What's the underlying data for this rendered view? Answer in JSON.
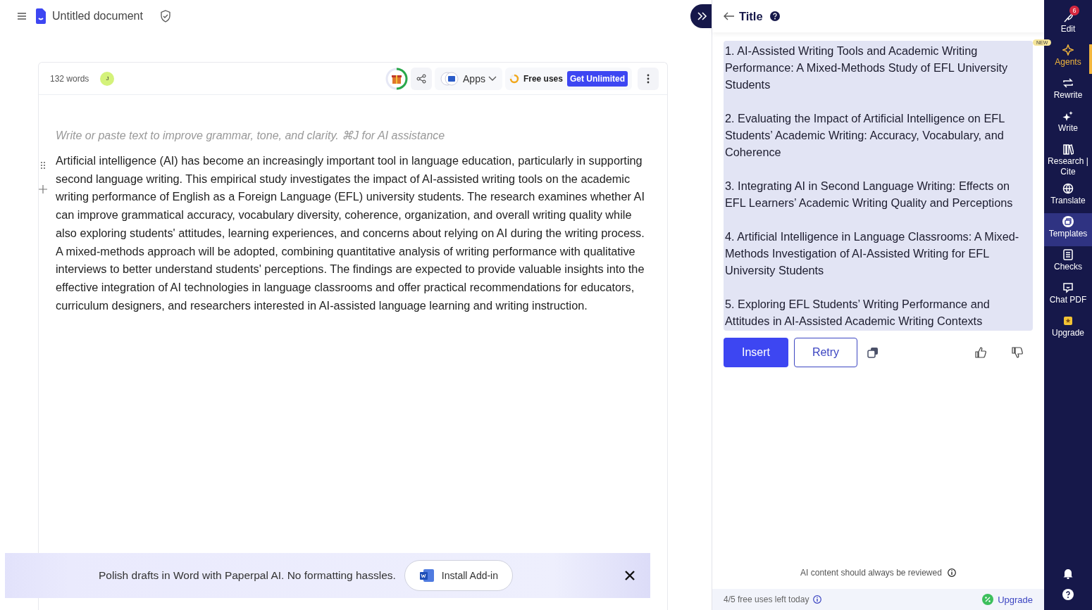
{
  "header": {
    "title": "Untitled document"
  },
  "toolbar": {
    "word_count": "132 words",
    "avatar": "J",
    "apps_label": "Apps",
    "free_uses": "Free uses",
    "get_unlimited": "Get Unlimited"
  },
  "editor": {
    "placeholder": "Write or paste text to improve grammar, tone, and clarity. ⌘J for AI assistance",
    "paragraph": "Artificial intelligence (AI) has become an increasingly important tool in language education, particularly in supporting second language writing. This empirical study investigates the impact of AI-assisted writing tools on the academic writing performance of English as a Foreign Language (EFL) university students. The research examines whether AI can improve grammatical accuracy, vocabulary diversity, coherence, organization, and overall writing quality while also exploring students' attitudes, learning experiences, and concerns about relying on AI during the writing process. A mixed-methods approach will be adopted, combining quantitative analysis of writing performance with qualitative interviews to better understand students' perceptions. The findings are expected to provide valuable insights into the effective integration of AI technologies in language classrooms and offer practical recommendations for educators, curriculum designers, and researchers interested in AI-assisted language learning and writing instruction."
  },
  "banner": {
    "message": "Polish drafts in Word with Paperpal AI. No formatting hassles.",
    "button": "Install Add-in"
  },
  "panel": {
    "title": "Title",
    "results": [
      "1. AI-Assisted Writing Tools and Academic Writing Performance: A Mixed-Methods Study of EFL University Students",
      "2. Evaluating the Impact of Artificial Intelligence on EFL Students’ Academic Writing: Accuracy, Vocabulary, and Coherence",
      "3. Integrating AI in Second Language Writing: Effects on EFL Learners’ Academic Writing Quality and Perceptions",
      "4. Artificial Intelligence in Language Classrooms: A Mixed-Methods Investigation of AI-Assisted Writing for EFL University Students",
      "5. Exploring EFL Students’ Writing Performance and Attitudes in AI-Assisted Academic Writing Contexts"
    ],
    "insert": "Insert",
    "retry": "Retry",
    "notice": "AI content should always be reviewed",
    "usage": "4/5 free uses left today",
    "upgrade": "Upgrade"
  },
  "rail": {
    "items": [
      {
        "label": "Edit",
        "kind": "tool",
        "badge": "6",
        "selected": false
      },
      {
        "label": "Agents",
        "kind": "promo",
        "tag": "NEW",
        "selected": false
      },
      {
        "label": "Rewrite",
        "kind": "tool",
        "selected": false
      },
      {
        "label": "Write",
        "kind": "tool",
        "selected": false
      },
      {
        "label": "Research | Cite",
        "kind": "tool",
        "selected": false
      },
      {
        "label": "Translate",
        "kind": "tool",
        "selected": false
      },
      {
        "label": "Templates",
        "kind": "tool",
        "selected": true
      },
      {
        "label": "Checks",
        "kind": "tool",
        "selected": false
      },
      {
        "label": "Chat PDF",
        "kind": "tool",
        "selected": false
      },
      {
        "label": "Upgrade",
        "kind": "tool",
        "selected": false
      }
    ]
  }
}
